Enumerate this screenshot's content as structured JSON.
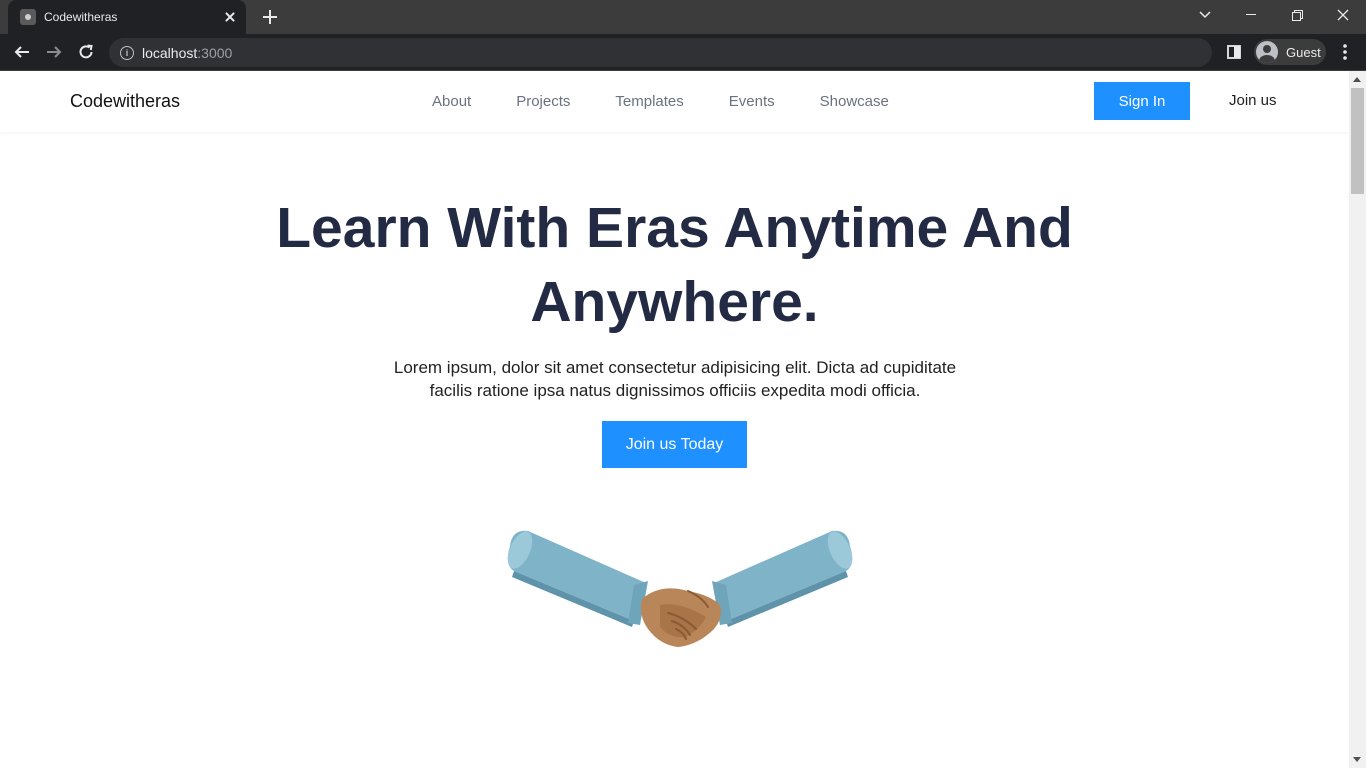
{
  "browser": {
    "tab_title": "Codewitheras",
    "address_host": "localhost",
    "address_port": ":3000",
    "profile_label": "Guest"
  },
  "nav": {
    "brand": "Codewitheras",
    "links": [
      "About",
      "Projects",
      "Templates",
      "Events",
      "Showcase"
    ],
    "signin_label": "Sign In",
    "join_label": "Join us"
  },
  "hero": {
    "title_line1": "Learn With Eras Anytime And",
    "title_line2": "Anywhere.",
    "text_line1": "Lorem ipsum, dolor sit amet consectetur adipisicing elit. Dicta ad cupiditate",
    "text_line2": "facilis ratione ipsa natus dignissimos officiis expedita modi officia.",
    "cta_label": "Join us Today",
    "illustration": "handshake-illustration"
  },
  "colors": {
    "accent": "#1e90ff",
    "heading": "#232a43",
    "nav_text": "#6b7280",
    "chrome_dark": "#202124"
  }
}
